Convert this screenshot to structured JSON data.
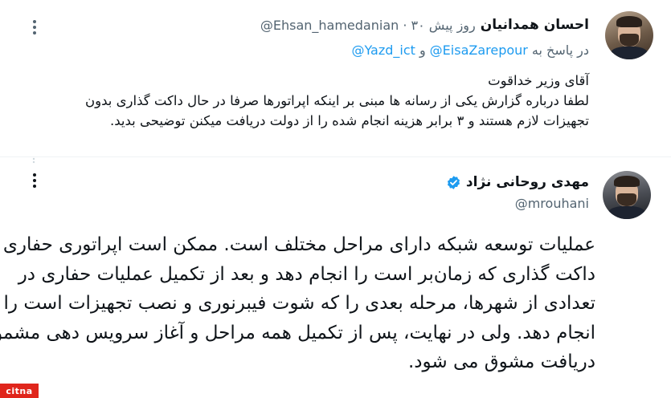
{
  "tweet1": {
    "author_name": "احسان همدانیان",
    "meta": "@Ehsan_hamedanian · ۳۰ روز پیش",
    "reply_prefix": "در پاسخ به",
    "reply_mention1": "@EisaZarepour",
    "reply_and": "و",
    "reply_mention2": "@Yazd_ict",
    "body_lines": [
      "آقای وزیر خداقوت",
      "لطفا درباره گزارش یکی از رسانه ها مبنی بر اینکه اپراتورها صرفا در حال داکت گذاری بدون",
      "تجهیزات لازم هستند و ۳ برابر هزینه انجام شده را از دولت دریافت میکنن توضیحی بدید."
    ]
  },
  "tweet2": {
    "author_name": "مهدی روحانی نژاد",
    "handle": "@mrouhani",
    "body_lines": [
      "عملیات توسعه شبکه دارای مراحل مختلف است. ممکن است اپراتوری حفاری و",
      "داکت گذاری که زمان‌بر است را انجام دهد و بعد از تکمیل عملیات حفاری در",
      "تعدادی از شهرها، مرحله بعدی را که شوت فیبرنوری و نصب تجهیزات است را",
      "انجام دهد. ولی در نهایت، پس از تکمیل همه مراحل و آغاز سرویس دهی مشمول",
      "دریافت مشوق می شود."
    ]
  },
  "watermark": "citna",
  "icons": {
    "more": "more-options-icon",
    "verified": "verified-badge-icon"
  },
  "colors": {
    "link": "#1d9bf0",
    "secondary_text": "#536471",
    "verified": "#1d9bf0",
    "watermark_bg": "#e0261c"
  }
}
